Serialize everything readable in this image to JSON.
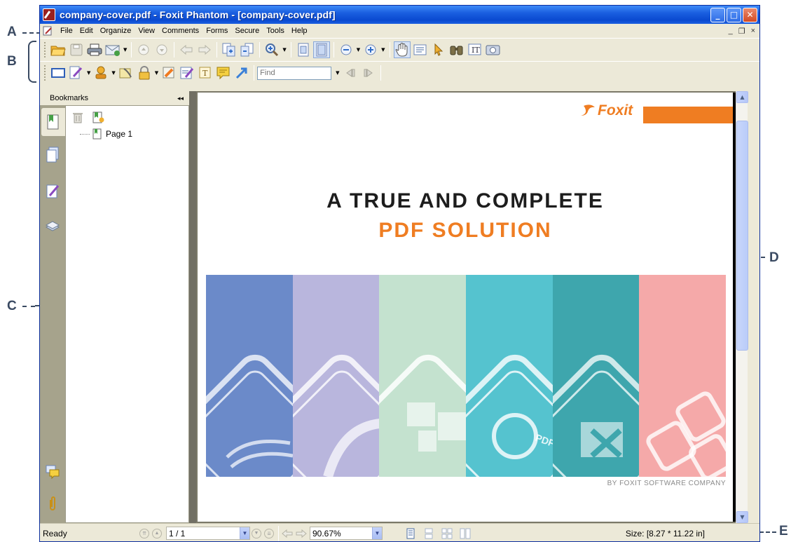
{
  "callouts": {
    "a": "A",
    "b": "B",
    "c": "C",
    "d": "D",
    "e": "E"
  },
  "window": {
    "title": "company-cover.pdf - Foxit Phantom - [company-cover.pdf]",
    "minimize_glyph": "_",
    "maximize_glyph": "□",
    "close_glyph": "✕"
  },
  "menubar": {
    "items": [
      "File",
      "Edit",
      "Organize",
      "View",
      "Comments",
      "Forms",
      "Secure",
      "Tools",
      "Help"
    ],
    "mdi_min": "_",
    "mdi_restore": "❐",
    "mdi_close": "×"
  },
  "toolbar": {
    "find_placeholder": "Find"
  },
  "panel": {
    "title": "Bookmarks",
    "collapse_glyph": "◂◂",
    "bookmarks": [
      {
        "label": "Page 1"
      }
    ]
  },
  "document": {
    "logo_text": "Foxit",
    "headline_line1": "A TRUE AND COMPLETE",
    "headline_line2": "PDF SOLUTION",
    "byline": "BY FOXIT SOFTWARE COMPANY",
    "stripe_colors": [
      "#6b8ac9",
      "#b9b6dd",
      "#c4e2cf",
      "#55c3cf",
      "#3ea6ad",
      "#f5a9a9"
    ],
    "stripe_badge": "PDF",
    "brand_orange": "#ef7d22"
  },
  "statusbar": {
    "status": "Ready",
    "page_value": "1 / 1",
    "zoom_value": "90.67%",
    "size_text": "Size: [8.27 * 11.22 in]"
  }
}
